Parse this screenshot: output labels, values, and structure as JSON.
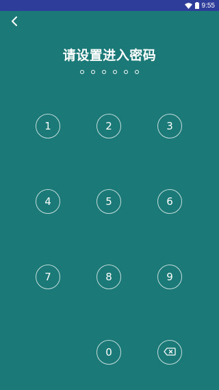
{
  "status_bar": {
    "time": "9:55",
    "icons": [
      "wifi-icon",
      "battery-icon"
    ]
  },
  "header": {
    "back_icon": "back-arrow-icon",
    "title": "请设置进入密码"
  },
  "pin": {
    "length": 6,
    "filled": 0
  },
  "keypad": {
    "keys": [
      "1",
      "2",
      "3",
      "4",
      "5",
      "6",
      "7",
      "8",
      "9",
      "0"
    ],
    "delete_icon": "backspace-icon"
  },
  "colors": {
    "background": "#1b7a78",
    "status_bar": "#2f3d9a",
    "foreground": "#ffffff"
  }
}
